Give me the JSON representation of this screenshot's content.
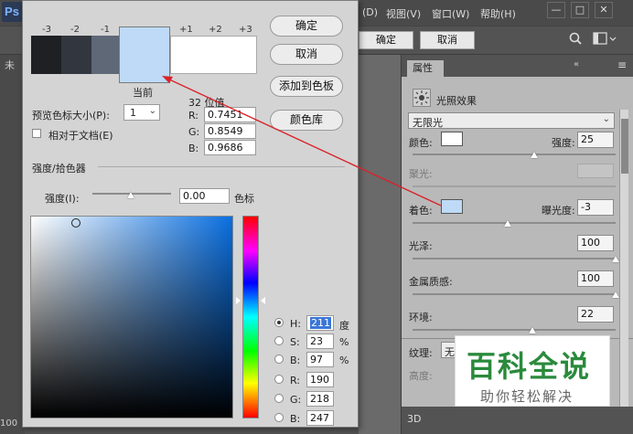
{
  "app": {
    "logo": "Ps",
    "menu": [
      "(D)",
      "视图(V)",
      "窗口(W)",
      "帮助(H)"
    ],
    "window_controls": [
      "—",
      "□",
      "✕"
    ],
    "options": {
      "confirm": "确定",
      "cancel": "取消"
    },
    "doc_tab": "未",
    "bottom_left": "100"
  },
  "properties": {
    "tab": "属性",
    "menu_icon": "≡",
    "section_title": "光照效果",
    "light_type": "无限光",
    "color_label": "颜色:",
    "color_value": "#ffffff",
    "intensity_label": "强度:",
    "intensity": "25",
    "intensity_level": 0.6,
    "hotspot_label": "聚光:",
    "colorize_label": "着色:",
    "colorize_value": "#bedaf7",
    "exposure_label": "曝光度:",
    "exposure": "-3",
    "exposure_level": 0.47,
    "gloss_label": "光泽:",
    "gloss": "100",
    "gloss_level": 1.0,
    "metallic_label": "金属质感:",
    "metallic": "100",
    "metallic_level": 1.0,
    "ambience_label": "环境:",
    "ambience": "22",
    "ambience_level": 0.59,
    "texture_label": "纹理:",
    "texture_value": "无",
    "height_label": "高度:",
    "bottom_tab": "3D"
  },
  "dialog": {
    "offsets": [
      "-3",
      "-2",
      "-1",
      "+1",
      "+2",
      "+3"
    ],
    "swatch_colors": [
      "#1e2024",
      "#32373f",
      "#5e6877",
      "#bedaf7",
      "#ffffff"
    ],
    "current_label": "当前",
    "buttons": {
      "ok": "确定",
      "cancel": "取消",
      "add_to_swatches": "添加到色板",
      "color_libraries": "颜色库"
    },
    "preview_size_label": "预览色标大小(P):",
    "preview_size": "1",
    "relative_label": "相对于文档(E)",
    "bit_label": "32 位值",
    "r32_label": "R:",
    "r32": "0.7451",
    "g32_label": "G:",
    "g32": "0.8549",
    "b32_label": "B:",
    "b32": "0.9686",
    "intensity_section": "强度/拾色器",
    "intensity_label": "强度(I):",
    "intensity_value": "0.00",
    "stops_label": "色标",
    "h_label": "H:",
    "h": "211",
    "h_unit": "度",
    "s_label": "S:",
    "s": "23",
    "s_unit": "%",
    "b_label": "B:",
    "b": "97",
    "b_unit": "%",
    "r_label": "R:",
    "r": "190",
    "g_label": "G:",
    "g": "218",
    "bb_label": "B:",
    "bb": "247"
  },
  "watermark": {
    "big": "百科全说",
    "small": "助你轻松解决"
  }
}
